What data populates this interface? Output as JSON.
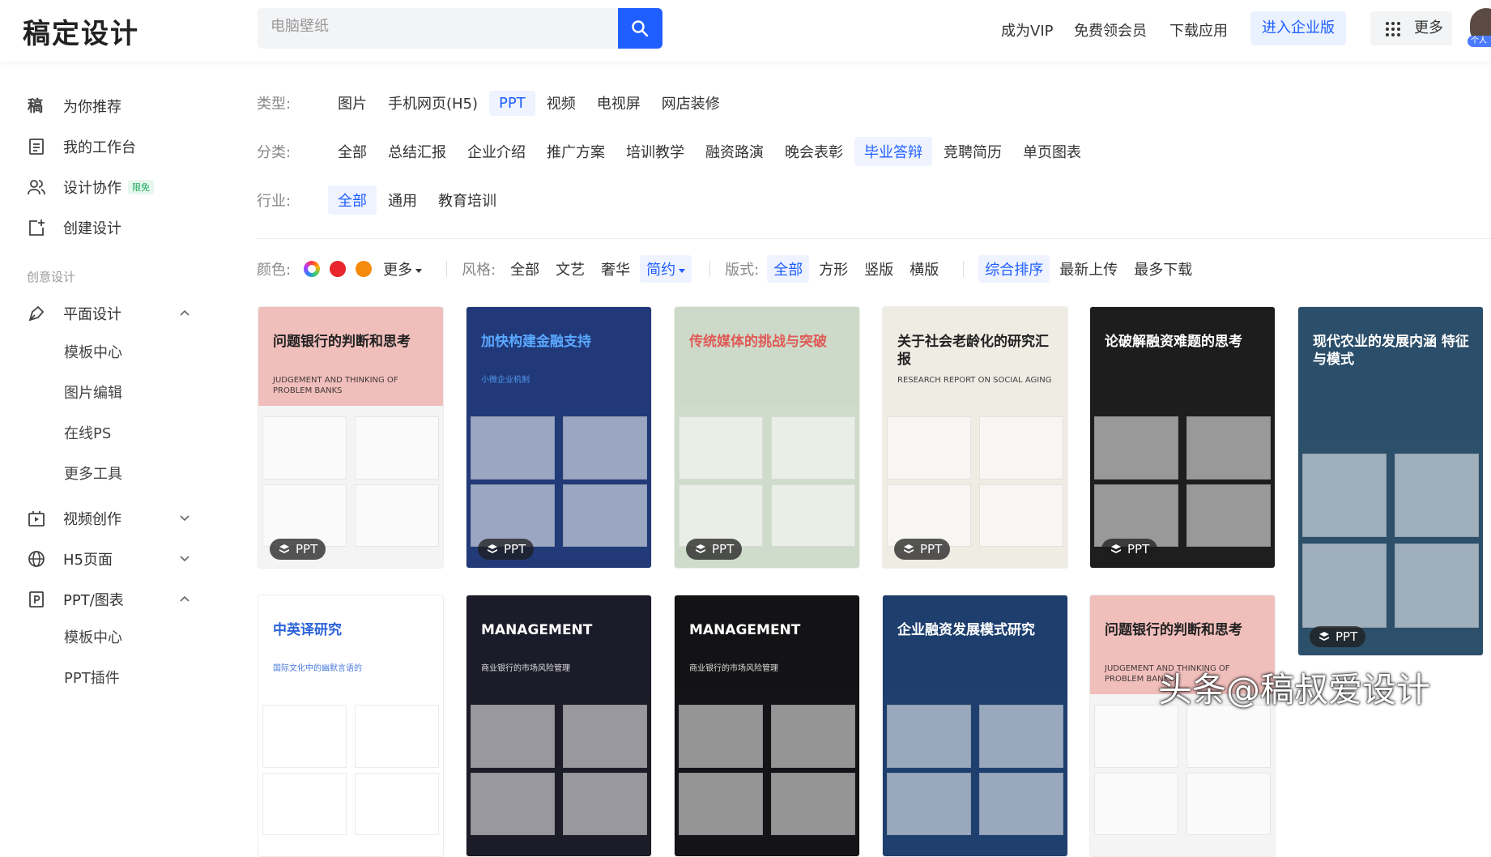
{
  "header": {
    "logo": "稿定设计",
    "search_placeholder": "电脑壁纸",
    "nav": [
      "成为VIP",
      "免费领会员",
      "下载应用"
    ],
    "enterprise": "进入企业版",
    "more": "更多",
    "avatar_badge": "个人"
  },
  "sidebar": {
    "items": [
      {
        "label": "为你推荐",
        "icon": "gao-logo-icon"
      },
      {
        "label": "我的工作台",
        "icon": "document-icon"
      },
      {
        "label": "设计协作",
        "icon": "users-icon",
        "tag": "限免"
      },
      {
        "label": "创建设计",
        "icon": "add-design-icon"
      }
    ],
    "section_label": "创意设计",
    "groups": [
      {
        "label": "平面设计",
        "icon": "pen-icon",
        "expanded": true,
        "children": [
          "模板中心",
          "图片编辑",
          "在线PS",
          "更多工具"
        ]
      },
      {
        "label": "视频创作",
        "icon": "video-icon",
        "expanded": false,
        "children": []
      },
      {
        "label": "H5页面",
        "icon": "globe-icon",
        "expanded": false,
        "children": []
      },
      {
        "label": "PPT/图表",
        "icon": "ppt-icon",
        "expanded": true,
        "children": [
          "模板中心",
          "PPT插件"
        ]
      }
    ]
  },
  "filters": {
    "type": {
      "label": "类型:",
      "options": [
        "图片",
        "手机网页(H5)",
        "PPT",
        "视频",
        "电视屏",
        "网店装修"
      ],
      "selected": 2
    },
    "category": {
      "label": "分类:",
      "options": [
        "全部",
        "总结汇报",
        "企业介绍",
        "推广方案",
        "培训教学",
        "融资路演",
        "晚会表彰",
        "毕业答辩",
        "竞聘简历",
        "单页图表"
      ],
      "selected": 7
    },
    "industry": {
      "label": "行业:",
      "options": [
        "全部",
        "通用",
        "教育培训"
      ],
      "selected": 0
    },
    "color": {
      "label": "颜色:",
      "swatches": [
        "#ff4d4f",
        "#e8262b",
        "#f58a0b"
      ],
      "more": "更多"
    },
    "style": {
      "label": "风格:",
      "options": [
        "全部",
        "文艺",
        "奢华",
        "简约"
      ],
      "selected": 3
    },
    "layout": {
      "label": "版式:",
      "options": [
        "全部",
        "方形",
        "竖版",
        "横版"
      ],
      "selected": 0
    },
    "sort": {
      "options": [
        "综合排序",
        "最新上传",
        "最多下载"
      ],
      "selected": 0
    }
  },
  "cards": [
    {
      "title": "问题银行的判断和思考",
      "subtitle": "JUDGEMENT AND THINKING OF PROBLEM BANKS",
      "badge": "PPT",
      "theme": "#e85a4f",
      "bg": "#f4f4f4",
      "fg": "#222"
    },
    {
      "title": "加快构建金融支持",
      "subtitle": "小微企业机制",
      "badge": "PPT",
      "theme": "#1f3a7a",
      "bg": "#223a78",
      "fg": "#5aa8ff"
    },
    {
      "title": "传统媒体的挑战与突破",
      "subtitle": "",
      "badge": "PPT",
      "theme": "#c9d6c5",
      "bg": "#cfdccb",
      "fg": "#e05a57"
    },
    {
      "title": "关于社会老龄化的研究汇报",
      "subtitle": "RESEARCH REPORT ON SOCIAL AGING",
      "badge": "PPT",
      "theme": "#f0ede4",
      "bg": "#efece3",
      "fg": "#222"
    },
    {
      "title": "论破解融资难题的思考",
      "subtitle": "",
      "badge": "PPT",
      "theme": "#1c1c1c",
      "bg": "#1e1e1e",
      "fg": "#fff"
    },
    {
      "title": "现代农业的发展内涵 特征与模式",
      "subtitle": "",
      "badge": "PPT",
      "theme": "#2b4e6b",
      "bg": "#2c4f6a",
      "fg": "#fff"
    },
    {
      "title": "中英译研究",
      "subtitle": "国际文化中的幽默言语的",
      "badge": "",
      "theme": "#fff",
      "bg": "#ffffff",
      "fg": "#2a63d8"
    },
    {
      "title": "MANAGEMENT",
      "subtitle": "商业银行的市场风险管理",
      "badge": "",
      "theme": "#1a1a2a",
      "bg": "#1c1c28",
      "fg": "#fff"
    },
    {
      "title": "MANAGEMENT",
      "subtitle": "商业银行的市场风险管理",
      "badge": "",
      "theme": "#111",
      "bg": "#141418",
      "fg": "#fff"
    },
    {
      "title": "企业融资发展模式研究",
      "subtitle": "",
      "badge": "",
      "theme": "#1e3e6e",
      "bg": "#1f3f6f",
      "fg": "#fff"
    },
    {
      "title": "问题银行的判断和思考",
      "subtitle": "JUDGEMENT AND THINKING OF PROBLEM BANKS",
      "badge": "",
      "theme": "#e85a4f",
      "bg": "#f4f4f4",
      "fg": "#222"
    }
  ],
  "watermark": "头条@稿叔爱设计"
}
